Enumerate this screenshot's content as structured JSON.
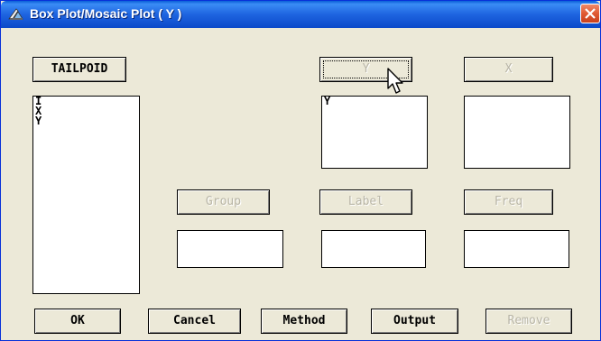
{
  "window": {
    "title": "Box Plot/Mosaic Plot ( Y )",
    "title_icon": "plot-icon",
    "close_icon": "close-icon"
  },
  "dataset_button": {
    "label": "TAILPOID"
  },
  "variables_list": {
    "items": [
      "I",
      "X",
      "Y"
    ]
  },
  "role_buttons": {
    "y": {
      "label": "Y",
      "enabled": false,
      "focused": true
    },
    "x": {
      "label": "X",
      "enabled": false
    },
    "group": {
      "label": "Group",
      "enabled": false
    },
    "label": {
      "label": "Label",
      "enabled": false
    },
    "freq": {
      "label": "Freq",
      "enabled": false
    }
  },
  "role_lists": {
    "y": [
      "Y"
    ],
    "x": [],
    "group": [],
    "label": [],
    "freq": []
  },
  "bottom_buttons": {
    "ok": "OK",
    "cancel": "Cancel",
    "method": "Method",
    "output": "Output",
    "remove": "Remove"
  },
  "colors": {
    "titlebar": "#1e64e0",
    "dialog_bg": "#ece9d8",
    "close_button": "#e05a33"
  }
}
